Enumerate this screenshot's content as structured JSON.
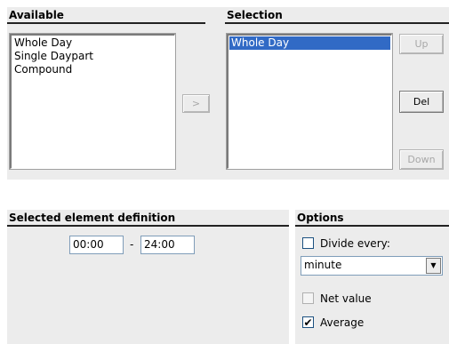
{
  "available": {
    "title": "Available",
    "items": [
      "Whole Day",
      "Single Daypart",
      "Compound"
    ]
  },
  "move_button": ">",
  "selection": {
    "title": "Selection",
    "items": [
      "Whole Day"
    ],
    "buttons": {
      "up": "Up",
      "del": "Del",
      "down": "Down"
    }
  },
  "definition": {
    "title": "Selected element definition",
    "start": "00:00",
    "separator": "-",
    "end": "24:00"
  },
  "options": {
    "title": "Options",
    "divide_every_label": "Divide every:",
    "divide_every_checked": false,
    "unit": "minute",
    "net_value_label": "Net value",
    "net_value_checked": false,
    "average_label": "Average",
    "average_checked": true,
    "check_mark": "✔",
    "combo_arrow": "▼"
  }
}
